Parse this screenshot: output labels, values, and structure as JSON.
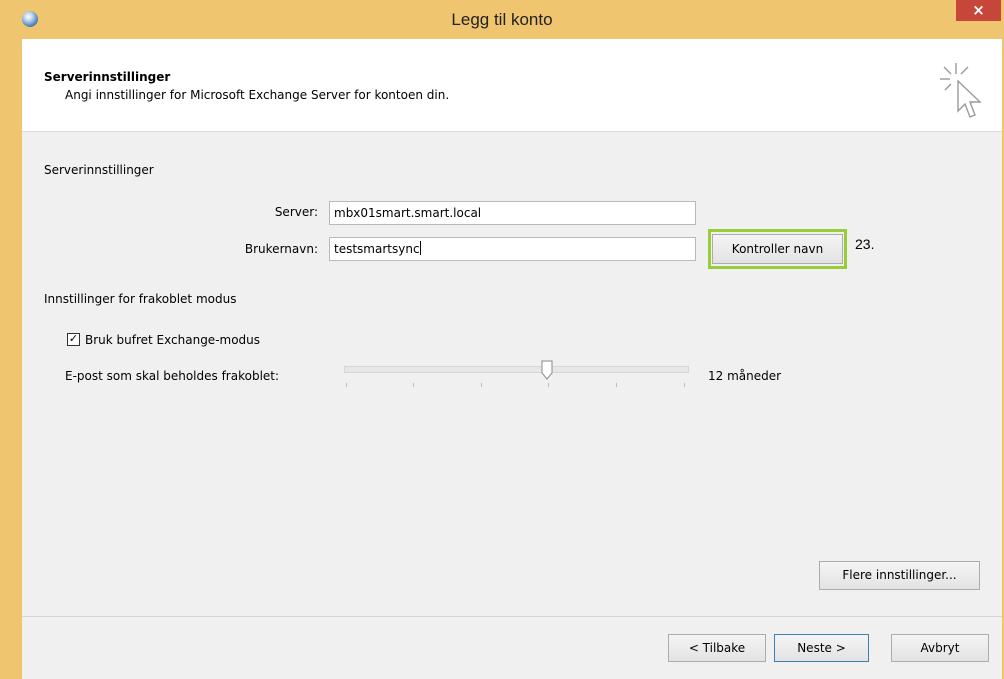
{
  "window": {
    "title": "Legg til konto",
    "close_symbol": "×",
    "app_icon": "outlook-globe-icon",
    "accent_color": "#efc56f"
  },
  "header": {
    "title": "Serverinnstillinger",
    "subtitle": "Angi innstillinger for Microsoft Exchange Server for kontoen din.",
    "icon": "cursor-sparkle-icon"
  },
  "server_section": {
    "label": "Serverinnstillinger",
    "server_label": "Server:",
    "server_value": "mbx01smart.smart.local",
    "username_label": "Brukernavn:",
    "username_value": "testsmartsync",
    "check_name_button": "Kontroller navn",
    "annotation": "23."
  },
  "offline_section": {
    "label": "Innstillinger for frakoblet modus",
    "cached_mode_label": "Bruk bufret Exchange-modus",
    "cached_mode_checked": true,
    "mail_to_keep_label": "E-post som skal beholdes frakoblet:",
    "slider_value_label": "12 måneder",
    "slider_level_fraction": 0.6
  },
  "more_settings_button": "Flere innstillinger...",
  "footer": {
    "back_button": "< Tilbake",
    "next_button": "Neste >",
    "cancel_button": "Avbryt"
  }
}
